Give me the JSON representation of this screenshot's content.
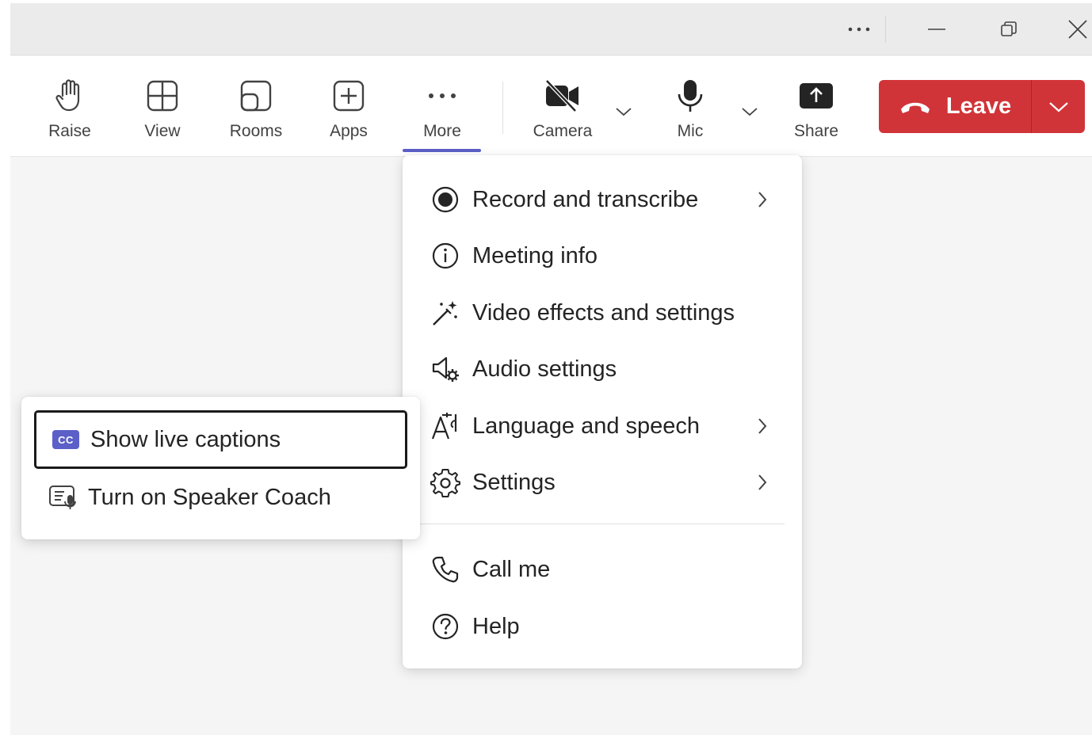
{
  "titlebar": {
    "more_icon": "ellipsis-icon",
    "controls": [
      "minimize-icon",
      "restore-icon",
      "close-icon"
    ]
  },
  "toolbar": {
    "raise": {
      "label": "Raise",
      "icon": "hand-icon"
    },
    "view": {
      "label": "View",
      "icon": "grid-icon"
    },
    "rooms": {
      "label": "Rooms",
      "icon": "rooms-icon"
    },
    "apps": {
      "label": "Apps",
      "icon": "add-square-icon"
    },
    "more": {
      "label": "More",
      "icon": "ellipsis-icon",
      "active": true
    },
    "camera": {
      "label": "Camera",
      "icon": "camera-off-icon"
    },
    "mic": {
      "label": "Mic",
      "icon": "mic-icon"
    },
    "share": {
      "label": "Share",
      "icon": "share-tray-icon"
    },
    "leave": {
      "label": "Leave",
      "icon": "phone-hangup-icon"
    }
  },
  "more_menu": {
    "items": [
      {
        "label": "Record and transcribe",
        "icon": "record-icon",
        "has_submenu": true
      },
      {
        "label": "Meeting info",
        "icon": "info-icon",
        "has_submenu": false
      },
      {
        "label": "Video effects and settings",
        "icon": "magic-wand-icon",
        "has_submenu": false
      },
      {
        "label": "Audio settings",
        "icon": "speaker-settings-icon",
        "has_submenu": false
      },
      {
        "label": "Language and speech",
        "icon": "language-icon",
        "has_submenu": true
      },
      {
        "label": "Settings",
        "icon": "gear-icon",
        "has_submenu": true
      }
    ],
    "footer_items": [
      {
        "label": "Call me",
        "icon": "phone-icon"
      },
      {
        "label": "Help",
        "icon": "help-icon"
      }
    ]
  },
  "language_submenu": {
    "items": [
      {
        "label": "Show live captions",
        "icon": "cc-icon",
        "badge": "CC",
        "focused": true
      },
      {
        "label": "Turn on Speaker Coach",
        "icon": "speaker-coach-icon",
        "focused": false
      }
    ]
  },
  "colors": {
    "accent": "#5b5fc7",
    "leave": "#d13438",
    "background": "#f5f5f5"
  }
}
